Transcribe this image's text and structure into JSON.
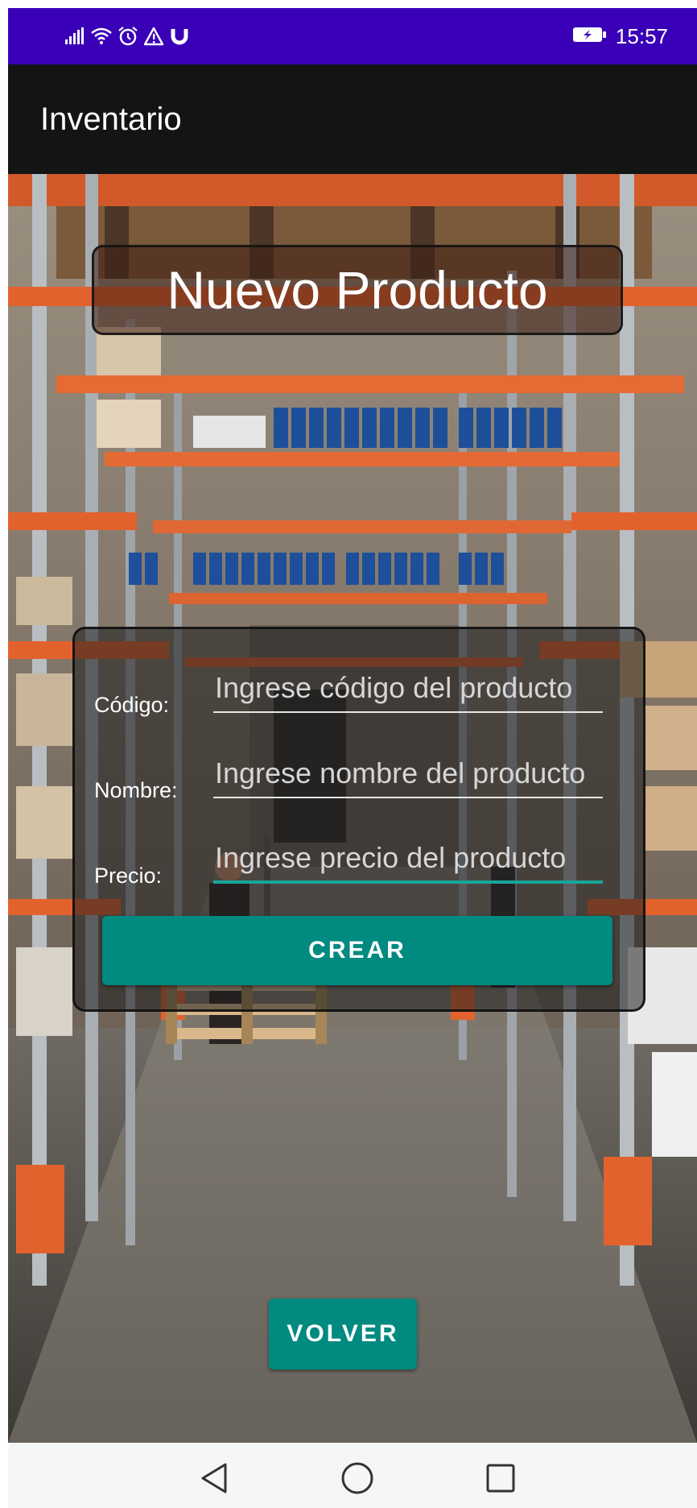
{
  "status_bar": {
    "time": "15:57",
    "color": "#3a00b8",
    "icons_left": [
      "signal-icon",
      "wifi-icon",
      "alarm-icon",
      "warning-icon",
      "magnet-icon"
    ],
    "icons_right": [
      "battery-charging-icon"
    ]
  },
  "app_bar": {
    "title": "Inventario",
    "color": "#141414"
  },
  "main": {
    "title": "Nuevo Producto",
    "form": {
      "fields": [
        {
          "label": "Código:",
          "placeholder": "Ingrese código del producto",
          "value": ""
        },
        {
          "label": "Nombre:",
          "placeholder": "Ingrese nombre del producto",
          "value": ""
        },
        {
          "label": "Precio:",
          "placeholder": "Ingrese precio del producto",
          "value": "",
          "focused": true
        }
      ],
      "submit_label": "CREAR"
    },
    "back_label": "VOLVER",
    "accent_color": "#008a80"
  },
  "nav_bar": {
    "buttons": [
      "back-triangle-icon",
      "home-circle-icon",
      "recents-square-icon"
    ]
  }
}
